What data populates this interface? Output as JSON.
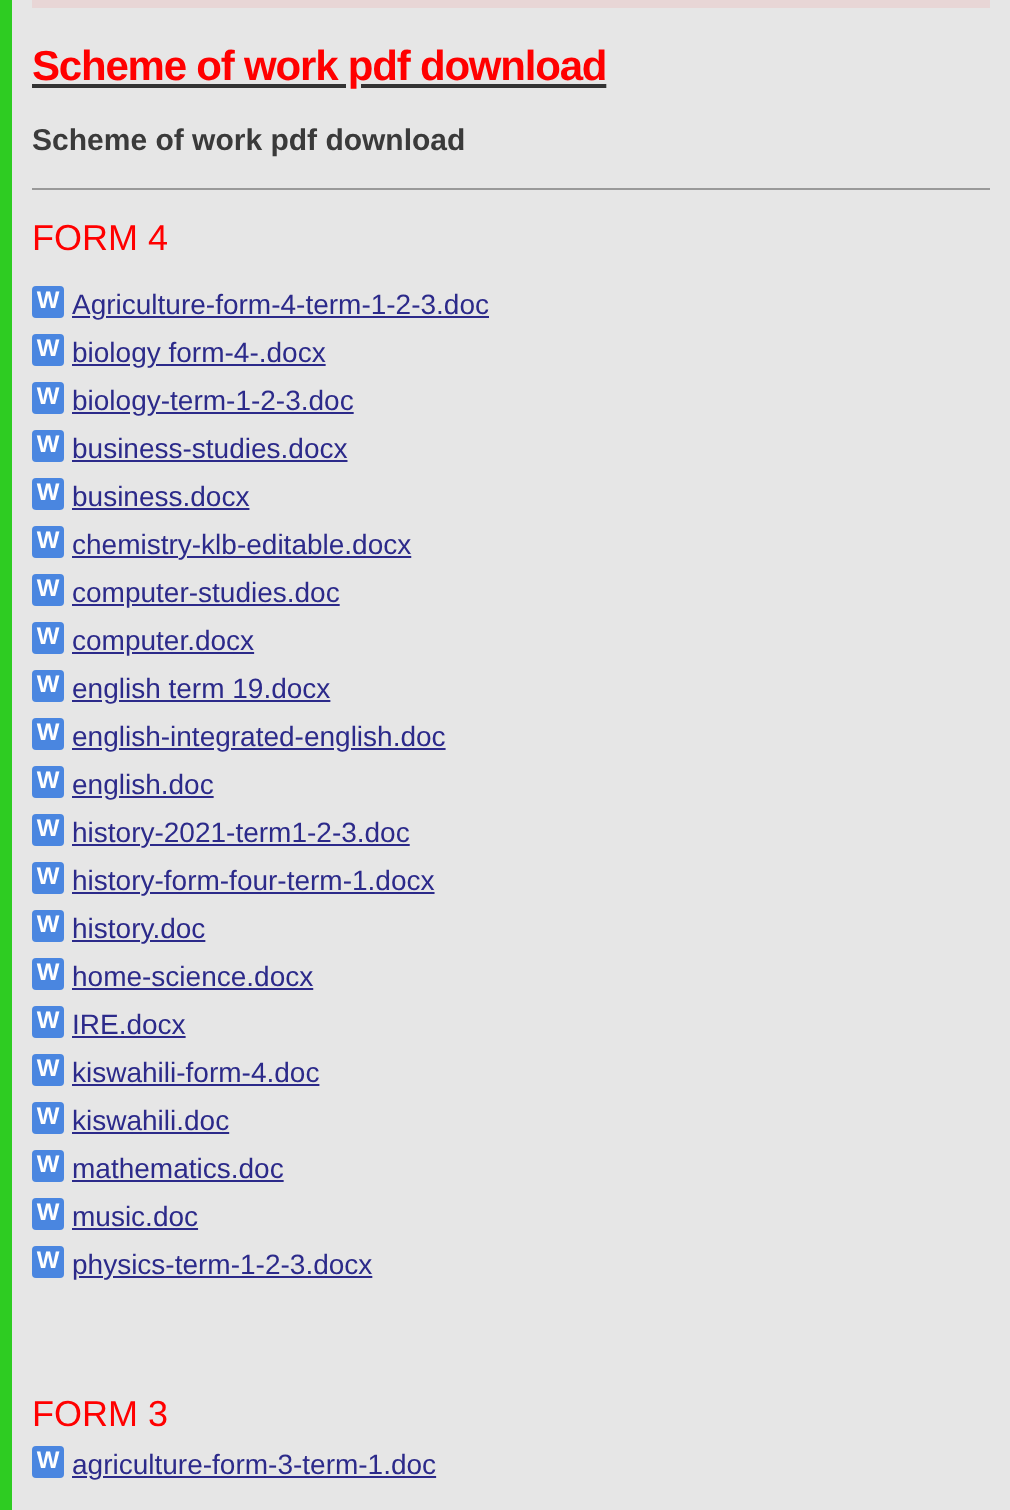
{
  "title": "Scheme of work pdf download",
  "subtitle": "Scheme of work pdf download",
  "sections": [
    {
      "heading": "FORM 4",
      "files": [
        {
          "badge": "W",
          "name": "Agriculture-form-4-term-1-2-3.doc"
        },
        {
          "badge": "W",
          "name": "biology form-4-.docx"
        },
        {
          "badge": "W",
          "name": "biology-term-1-2-3.doc"
        },
        {
          "badge": "W",
          "name": "business-studies.docx"
        },
        {
          "badge": "W",
          "name": "business.docx"
        },
        {
          "badge": "W",
          "name": "chemistry-klb-editable.docx"
        },
        {
          "badge": "W",
          "name": "computer-studies.doc"
        },
        {
          "badge": "W",
          "name": "computer.docx"
        },
        {
          "badge": "W",
          "name": "english term 19.docx"
        },
        {
          "badge": "W",
          "name": "english-integrated-english.doc"
        },
        {
          "badge": "W",
          "name": "english.doc"
        },
        {
          "badge": "W",
          "name": "history-2021-term1-2-3.doc"
        },
        {
          "badge": "W",
          "name": "history-form-four-term-1.docx"
        },
        {
          "badge": "W",
          "name": "history.doc"
        },
        {
          "badge": "W",
          "name": "home-science.docx"
        },
        {
          "badge": "W",
          "name": "IRE.docx"
        },
        {
          "badge": "W",
          "name": "kiswahili-form-4.doc"
        },
        {
          "badge": "W",
          "name": "kiswahili.doc"
        },
        {
          "badge": "W",
          "name": "mathematics.doc"
        },
        {
          "badge": "W",
          "name": "music.doc"
        },
        {
          "badge": "W",
          "name": "physics-term-1-2-3.docx"
        }
      ]
    },
    {
      "heading": "FORM 3",
      "files": [
        {
          "badge": "W",
          "name": "agriculture-form-3-term-1.doc"
        }
      ]
    }
  ]
}
